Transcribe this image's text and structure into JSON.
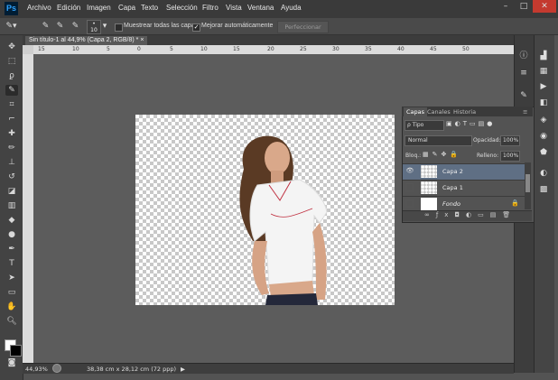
{
  "app": {
    "logo": "Ps"
  },
  "menu": [
    "Archivo",
    "Edición",
    "Imagen",
    "Capa",
    "Texto",
    "Selección",
    "Filtro",
    "Vista",
    "Ventana",
    "Ayuda"
  ],
  "window_controls": {
    "minimize": "–",
    "maximize": "□",
    "close": "✕"
  },
  "options": {
    "brush_size": "10",
    "sample_all_label": "Muestrear todas las capas",
    "sample_all_checked": false,
    "auto_enhance_label": "Mejorar automáticamente",
    "auto_enhance_checked": true,
    "refine_button": "Perfeccionar bor..."
  },
  "document": {
    "tab_title": "Sin título-1 al 44,9% (Capa 2, RGB/8) *",
    "close": "×"
  },
  "ruler_ticks": [
    "15",
    "10",
    "5",
    "0",
    "5",
    "10",
    "15",
    "20",
    "25",
    "30",
    "35",
    "40",
    "45",
    "50"
  ],
  "status": {
    "zoom": "44,93%",
    "doc_size": "38,38 cm x 28,12 cm (72 ppp)"
  },
  "layers_panel": {
    "tabs": [
      "Capas",
      "Canales",
      "Historia"
    ],
    "filter": "ρ Tipo",
    "blend_mode": "Normal",
    "opacity_label": "Opacidad:",
    "opacity_value": "100%",
    "lock_label": "Bloq.:",
    "fill_label": "Relleno:",
    "fill_value": "100%",
    "layers": [
      {
        "name": "Capa 2",
        "visible": true,
        "selected": true
      },
      {
        "name": "Capa 1",
        "visible": false,
        "selected": false
      },
      {
        "name": "Fondo",
        "visible": false,
        "selected": false
      }
    ]
  },
  "colors": {
    "accent": "#5f6f84",
    "close": "#c43a2f"
  }
}
